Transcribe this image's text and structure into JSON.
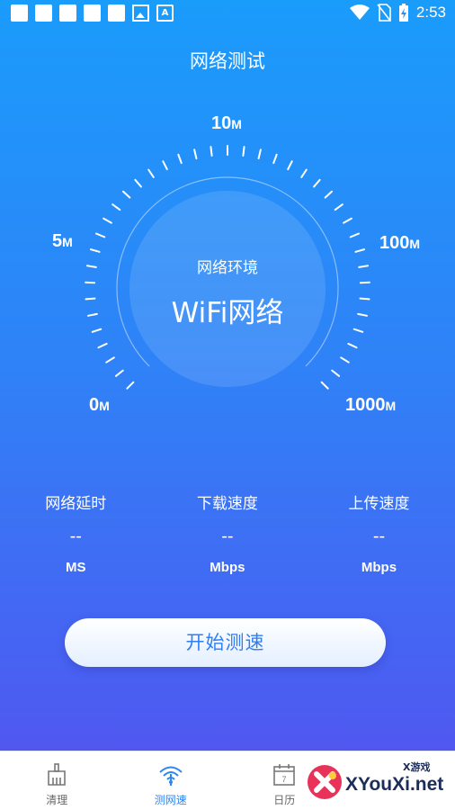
{
  "status_bar": {
    "time": "2:53"
  },
  "header": {
    "title": "网络测试"
  },
  "gauge": {
    "labels": [
      {
        "value": "10",
        "unit": "M"
      },
      {
        "value": "5",
        "unit": "M"
      },
      {
        "value": "100",
        "unit": "M"
      },
      {
        "value": "0",
        "unit": "M"
      },
      {
        "value": "1000",
        "unit": "M"
      }
    ],
    "environment_label": "网络环境",
    "environment_value": "WiFi网络"
  },
  "metrics": [
    {
      "label": "网络延时",
      "value": "--",
      "unit": "MS"
    },
    {
      "label": "下载速度",
      "value": "--",
      "unit": "Mbps"
    },
    {
      "label": "上传速度",
      "value": "--",
      "unit": "Mbps"
    }
  ],
  "start_button": {
    "label": "开始测速"
  },
  "bottom_nav": {
    "items": [
      {
        "label": "清理",
        "icon": "broom-icon",
        "active": false
      },
      {
        "label": "测网速",
        "icon": "wifi-icon",
        "active": true
      },
      {
        "label": "日历",
        "icon": "calendar-icon",
        "calendar_day": "7",
        "active": false
      }
    ]
  },
  "watermark": {
    "text": "XYouXi.net",
    "small_text": "X游戏"
  },
  "colors": {
    "gradient_top": "#1a9cfb",
    "gradient_bottom": "#5750ef",
    "accent": "#2f86f5"
  }
}
